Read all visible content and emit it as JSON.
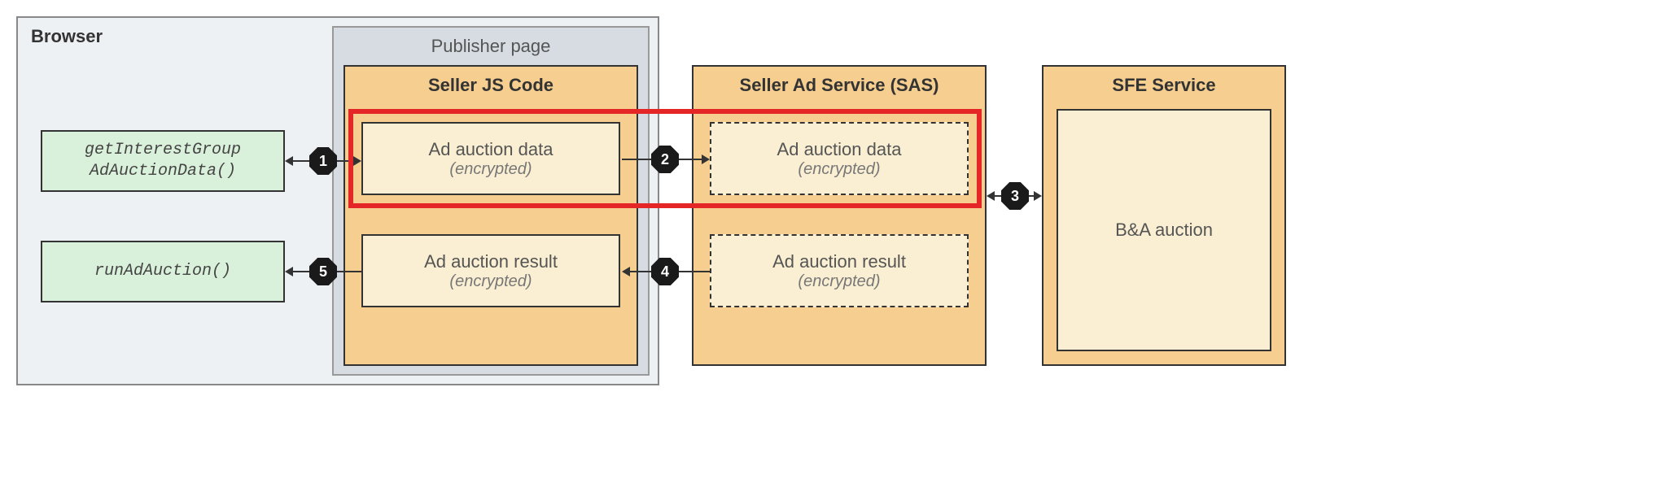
{
  "labels": {
    "browser": "Browser",
    "publisher": "Publisher page",
    "seller_js": "Seller JS Code",
    "sas": "Seller Ad Service (SAS)",
    "sfe": "SFE Service",
    "api_getInterestGroup": "getInterestGroup\nAdAuctionData()",
    "api_runAdAuction": "runAdAuction()",
    "ad_auction_data": "Ad auction data",
    "ad_auction_result": "Ad auction result",
    "encrypted": "(encrypted)",
    "ba_auction": "B&A auction"
  },
  "steps": {
    "s1": "1",
    "s2": "2",
    "s3": "3",
    "s4": "4",
    "s5": "5"
  }
}
